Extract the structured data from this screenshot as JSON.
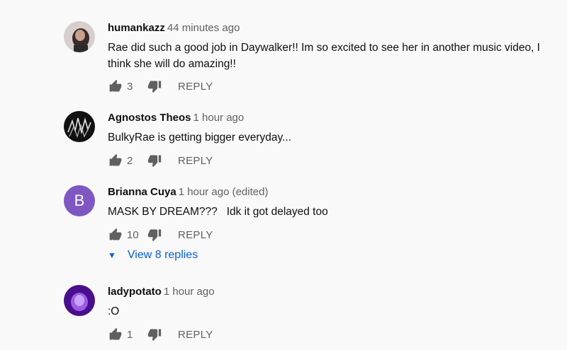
{
  "colors": {
    "background": "#f9f9f9",
    "link": "#065fd4",
    "muted": "#606060",
    "letter_avatar": "#7e57c2"
  },
  "action_labels": {
    "reply": "REPLY"
  },
  "comments": [
    {
      "author": "humankazz",
      "time": "44 minutes ago",
      "text": "Rae did such a good job in Daywalker!! Im so excited to see her in another music video, I think she will do amazing!!",
      "likes": "3",
      "avatar": "photo"
    },
    {
      "author": "Agnostos Theos",
      "time": "1 hour ago",
      "text": "BulkyRae is getting bigger everyday...",
      "likes": "2",
      "avatar": "photo"
    },
    {
      "author": "Brianna Cuya",
      "time": "1 hour ago (edited)",
      "text": "MASK BY DREAM???   Idk it got delayed too",
      "likes": "10",
      "avatar": "B",
      "view_replies": "View 8 replies"
    },
    {
      "author": "ladypotato",
      "time": "1 hour ago",
      "text": ":O",
      "likes": "1",
      "avatar": "photo"
    }
  ]
}
